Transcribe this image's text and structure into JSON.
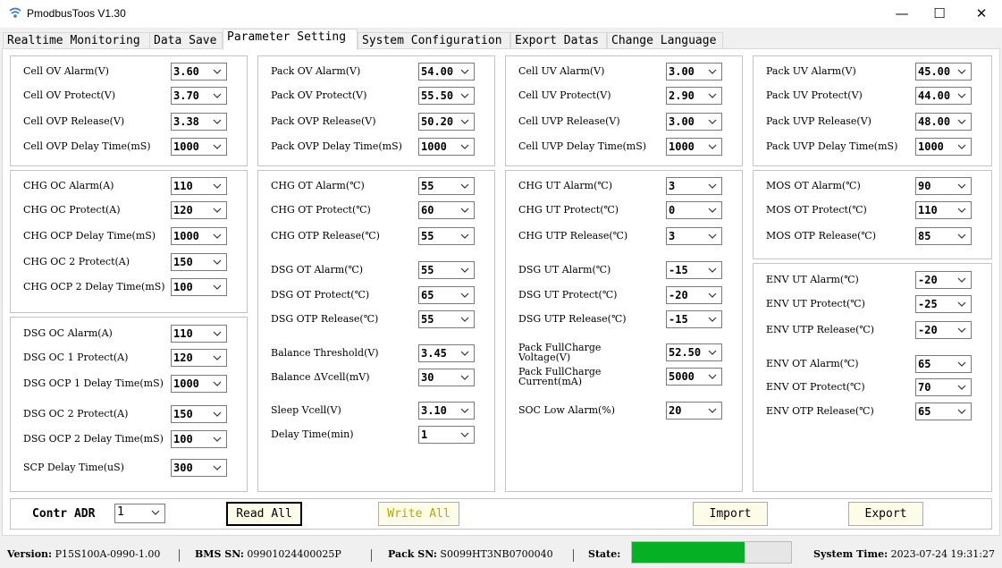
{
  "window": {
    "title": "PmodbusToos V1.30",
    "minimize": "—",
    "maximize": "☐",
    "close": "✕"
  },
  "tabs": [
    "Realtime Monitoring",
    "Data Save",
    "Parameter Setting",
    "System Configuration",
    "Export Datas",
    "Change Language"
  ],
  "active_tab": "Parameter Setting",
  "fields": [
    [
      "Cell OV Alarm(V)",
      "3.60"
    ],
    [
      "Cell OV Protect(V)",
      "3.70"
    ],
    [
      "Cell OVP Release(V)",
      "3.38"
    ],
    [
      "Cell OVP Delay Time(mS)",
      "1000"
    ],
    [
      "Pack OV Alarm(V)",
      "54.00"
    ],
    [
      "Pack OV Protect(V)",
      "55.50"
    ],
    [
      "Pack OVP Release(V)",
      "50.20"
    ],
    [
      "Pack OVP Delay Time(mS)",
      "1000"
    ],
    [
      "Cell UV Alarm(V)",
      "3.00"
    ],
    [
      "Cell UV Protect(V)",
      "2.90"
    ],
    [
      "Cell UVP Release(V)",
      "3.00"
    ],
    [
      "Cell UVP Delay Time(mS)",
      "1000"
    ],
    [
      "Pack UV Alarm(V)",
      "45.00"
    ],
    [
      "Pack UV Protect(V)",
      "44.00"
    ],
    [
      "Pack UVP Release(V)",
      "48.00"
    ],
    [
      "Pack UVP Delay Time(mS)",
      "1000"
    ],
    [
      "CHG OC Alarm(A)",
      "110"
    ],
    [
      "CHG OC Protect(A)",
      "120"
    ],
    [
      "CHG OCP Delay Time(mS)",
      "1000"
    ],
    [
      "CHG OC 2 Protect(A)",
      "150"
    ],
    [
      "CHG OCP 2 Delay Time(mS)",
      "100"
    ],
    [
      "DSG OC Alarm(A)",
      "110"
    ],
    [
      "DSG OC 1 Protect(A)",
      "120"
    ],
    [
      "DSG OCP 1 Delay Time(mS)",
      "1000"
    ],
    [
      "DSG OC 2 Protect(A)",
      "150"
    ],
    [
      "DSG OCP 2 Delay Time(mS)",
      "100"
    ],
    [
      "SCP Delay Time(uS)",
      "300"
    ],
    [
      "CHG OT Alarm(℃)",
      "55"
    ],
    [
      "CHG OT Protect(℃)",
      "60"
    ],
    [
      "CHG OTP Release(℃)",
      "55"
    ],
    [
      "DSG OT Alarm(℃)",
      "55"
    ],
    [
      "DSG OT Protect(℃)",
      "65"
    ],
    [
      "DSG OTP Release(℃)",
      "55"
    ],
    [
      "Balance Threshold(V)",
      "3.45"
    ],
    [
      "Balance ΔVcell(mV)",
      "30"
    ],
    [
      "Sleep Vcell(V)",
      "3.10"
    ],
    [
      "Delay Time(min)",
      "1"
    ],
    [
      "CHG UT Alarm(℃)",
      "3"
    ],
    [
      "CHG UT Protect(℃)",
      "0"
    ],
    [
      "CHG UTP Release(℃)",
      "3"
    ],
    [
      "DSG UT Alarm(℃)",
      "-15"
    ],
    [
      "DSG UT Protect(℃)",
      "-20"
    ],
    [
      "DSG UTP Release(℃)",
      "-15"
    ],
    [
      "Pack FullCharge\nVoltage(V)",
      "52.50"
    ],
    [
      "Pack FullCharge\nCurrent(mA)",
      "5000"
    ],
    [
      "SOC Low Alarm(%)",
      "20"
    ],
    [
      "MOS OT Alarm(℃)",
      "90"
    ],
    [
      "MOS OT Protect(℃)",
      "110"
    ],
    [
      "MOS OTP Release(℃)",
      "85"
    ],
    [
      "ENV UT Alarm(℃)",
      "-20"
    ],
    [
      "ENV UT Protect(℃)",
      "-25"
    ],
    [
      "ENV UTP Release(℃)",
      "-20"
    ],
    [
      "ENV OT Alarm(℃)",
      "65"
    ],
    [
      "ENV OT Protect(℃)",
      "70"
    ],
    [
      "ENV OTP Release(℃)",
      "65"
    ]
  ],
  "bottom": {
    "addr_label": "Contr ADR",
    "addr_value": "1",
    "read_all": "Read All",
    "write_all": "Write All",
    "import": "Import",
    "export": "Export"
  },
  "status": {
    "version_label": "Version:",
    "version": "P15S100A-0990-1.00",
    "bms_sn_label": "BMS SN:",
    "bms_sn": "09901024400025P",
    "pack_sn_label": "Pack SN:",
    "pack_sn": "S0099HT3NB0700040",
    "state_label": "State:",
    "state_progress": 0.71,
    "time_label": "System Time:",
    "time": "2023-07-24 19:31:27"
  },
  "colors": {
    "progress": "#06b025",
    "write_all_text": "#b8a800"
  }
}
